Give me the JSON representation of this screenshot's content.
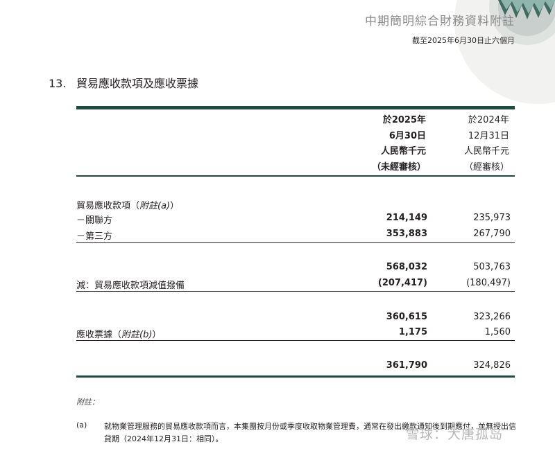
{
  "header": {
    "title": "中期簡明綜合財務資料附註",
    "subtitle": "截至2025年6月30日止六個月"
  },
  "section": {
    "number": "13.",
    "title": "貿易應收款項及應收票據"
  },
  "columns": [
    {
      "lines": [
        "於2025年",
        "6月30日",
        "人民幣千元",
        "（未經審核）"
      ]
    },
    {
      "lines": [
        "於2024年",
        "12月31日",
        "人民幣千元",
        "（經審核）"
      ]
    }
  ],
  "rows": {
    "heading": {
      "label": "貿易應收款項（",
      "note": "附註(a)",
      "end": "）"
    },
    "related": {
      "label": "－關聯方",
      "v1": "214,149",
      "v2": "235,973"
    },
    "third": {
      "label": "－第三方",
      "v1": "353,883",
      "v2": "267,790"
    },
    "subtotal": {
      "v1": "568,032",
      "v2": "503,763"
    },
    "provision": {
      "label": "減：貿易應收款項減值撥備",
      "v1": "(207,417)",
      "v2": "(180,497)"
    },
    "net": {
      "v1": "360,615",
      "v2": "323,266"
    },
    "bills": {
      "label": "應收票據（",
      "note": "附註(b)",
      "end": "）",
      "v1": "1,175",
      "v2": "1,560"
    },
    "total": {
      "v1": "361,790",
      "v2": "324,826"
    }
  },
  "notes": {
    "header": "附註：",
    "a_mark": "(a)",
    "a_text": "就物業管理服務的貿易應收款項而言，本集團按月份或季度收取物業管理費，通常在發出繳款通知後到期應付，並無授出信貸期（2024年12月31日：相同）。"
  },
  "watermark": "雪球：大唐孤岛"
}
